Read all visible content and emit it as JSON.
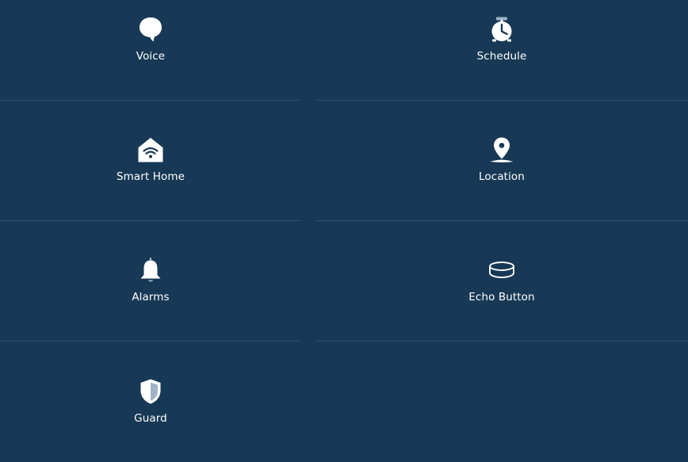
{
  "tiles": [
    {
      "id": "voice",
      "label": "Voice",
      "icon": "speech-bubble-icon"
    },
    {
      "id": "schedule",
      "label": "Schedule",
      "icon": "alarm-clock-icon"
    },
    {
      "id": "smart_home",
      "label": "Smart Home",
      "icon": "smart-home-icon"
    },
    {
      "id": "location",
      "label": "Location",
      "icon": "location-pin-icon"
    },
    {
      "id": "alarms",
      "label": "Alarms",
      "icon": "bell-icon"
    },
    {
      "id": "echo_button",
      "label": "Echo Button",
      "icon": "echo-button-icon"
    },
    {
      "id": "guard",
      "label": "Guard",
      "icon": "shield-icon"
    }
  ],
  "colors": {
    "background": "#173955",
    "divider": "#2e516d",
    "icon": "#ffffff",
    "icon_accent": "#9fb3c8",
    "text": "#ffffff"
  }
}
